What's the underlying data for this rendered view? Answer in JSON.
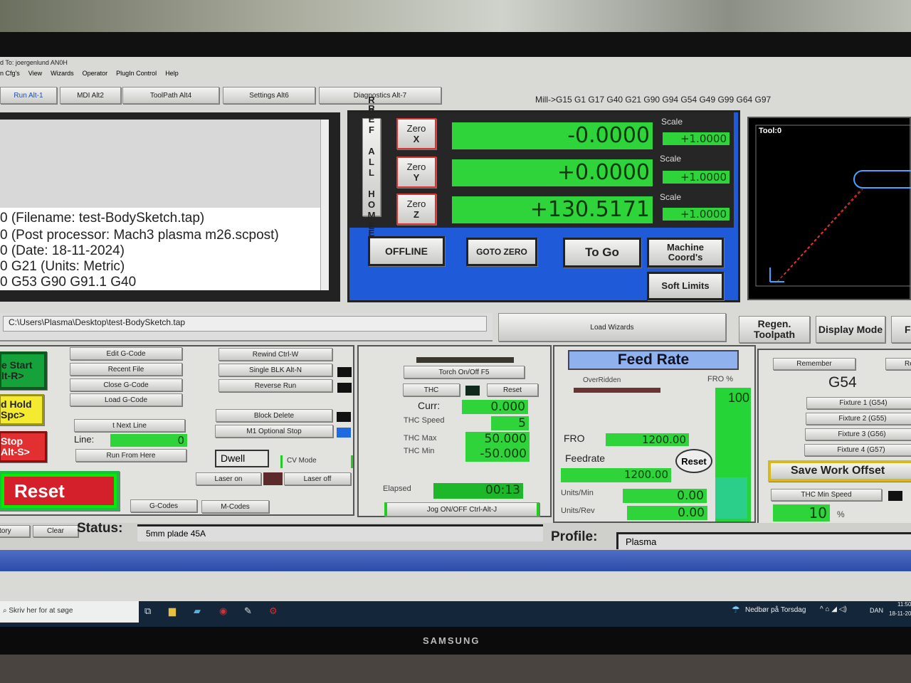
{
  "window": {
    "title": "d To: joergenlund AN0H"
  },
  "menu": [
    "n Cfg's",
    "View",
    "Wizards",
    "Operator",
    "PlugIn Control",
    "Help"
  ],
  "tabs": [
    "Run Alt-1",
    "MDI Alt2",
    "ToolPath Alt4",
    "Settings Alt6",
    "Diagnostics Alt-7"
  ],
  "mode_line": "Mill->G15  G1 G17 G40 G21 G90 G94 G54 G49 G99 G64 G97",
  "gcode": {
    "lines": [
      "0 (Filename: test-BodySketch.tap)",
      "0 (Post processor: Mach3 plasma m26.scpost)",
      "0 (Date: 18-11-2024)",
      "0 G21 (Units: Metric)",
      "0 G53 G90 G91.1 G40"
    ],
    "file_path": "C:\\Users\\Plasma\\Desktop\\test-BodySketch.tap"
  },
  "dro": {
    "ref_all_home": "REF ALL HOME",
    "axes": [
      {
        "zero": "Zero",
        "axis": "X",
        "value": "-0.0000",
        "scale_label": "Scale",
        "scale": "+1.0000"
      },
      {
        "zero": "Zero",
        "axis": "Y",
        "value": "+0.0000",
        "scale_label": "Scale",
        "scale": "+1.0000"
      },
      {
        "zero": "Zero",
        "axis": "Z",
        "value": "+130.5171",
        "scale_label": "Scale",
        "scale": "+1.0000"
      }
    ],
    "offline": "OFFLINE",
    "goto_zero": "GOTO ZERO",
    "to_go": "To Go",
    "machine_coords": "Machine Coord's",
    "soft_limits": "Soft Limits"
  },
  "toolpath": {
    "tool": "Tool:0",
    "regen": "Regen. Toolpath",
    "display_mode": "Display Mode",
    "f_partial": "F"
  },
  "load_wizards": "Load Wizards",
  "controls": {
    "cycle_start": "e Start\nlt-R>",
    "feed_hold": "d Hold\nSpc>",
    "stop": "Stop\nAlt-S>",
    "reset": "Reset",
    "edit": "Edit G-Code",
    "recent": "Recent File",
    "close": "Close G-Code",
    "load": "Load G-Code",
    "set_next": "t Next Line",
    "line_label": "Line:",
    "line_value": "0",
    "run_from_here": "Run From Here",
    "rewind": "Rewind Ctrl-W",
    "single_blk": "Single BLK Alt-N",
    "reverse_run": "Reverse Run",
    "block_delete": "Block Delete",
    "m1_stop": "M1 Optional Stop",
    "dwell": "Dwell",
    "cv_mode": "CV Mode",
    "laser_on": "Laser on",
    "laser_off": "Laser off",
    "gcodes": "G-Codes",
    "mcodes": "M-Codes"
  },
  "thc": {
    "torch": "Torch On/Off F5",
    "thc": "THC",
    "reset": "Reset",
    "curr_label": "Curr:",
    "curr": "0.000",
    "speed_label": "THC Speed",
    "speed": "5",
    "max_label": "THC Max",
    "max": "50.000",
    "min_label": "THC Min",
    "min": "-50.000",
    "elapsed_label": "Elapsed",
    "elapsed": "00:13",
    "jog": "Jog ON/OFF Ctrl-Alt-J"
  },
  "feed": {
    "title": "Feed Rate",
    "overridden": "OverRidden",
    "fro_pct_label": "FRO %",
    "fro_pct": "100",
    "fro_label": "FRO",
    "fro": "1200.00",
    "feedrate_label": "Feedrate",
    "feedrate": "1200.00",
    "reset": "Reset",
    "upm_label": "Units/Min",
    "upm": "0.00",
    "upr_label": "Units/Rev",
    "upr": "0.00"
  },
  "offsets": {
    "remember": "Remember",
    "return_partial": "Re",
    "current": "G54",
    "fixtures": [
      "Fixture 1 (G54)",
      "Fixture 2 (G55)",
      "Fixture 3 (G56)",
      "Fixture 4 (G57)"
    ],
    "save": "Save Work Offset",
    "thc_min_speed": "THC Min Speed",
    "thc_min_value": "10",
    "pct": "%"
  },
  "status": {
    "history": "tory",
    "clear": "Clear",
    "label": "Status:",
    "text": "5mm plade 45A",
    "profile_label": "Profile:",
    "profile": "Plasma"
  },
  "taskbar": {
    "search": "Skriv her for at søge",
    "weather": "Nedbør på Torsdag",
    "lang": "DAN",
    "time": "11:50",
    "date": "18-11-20"
  },
  "monitor_brand": "SAMSUNG"
}
